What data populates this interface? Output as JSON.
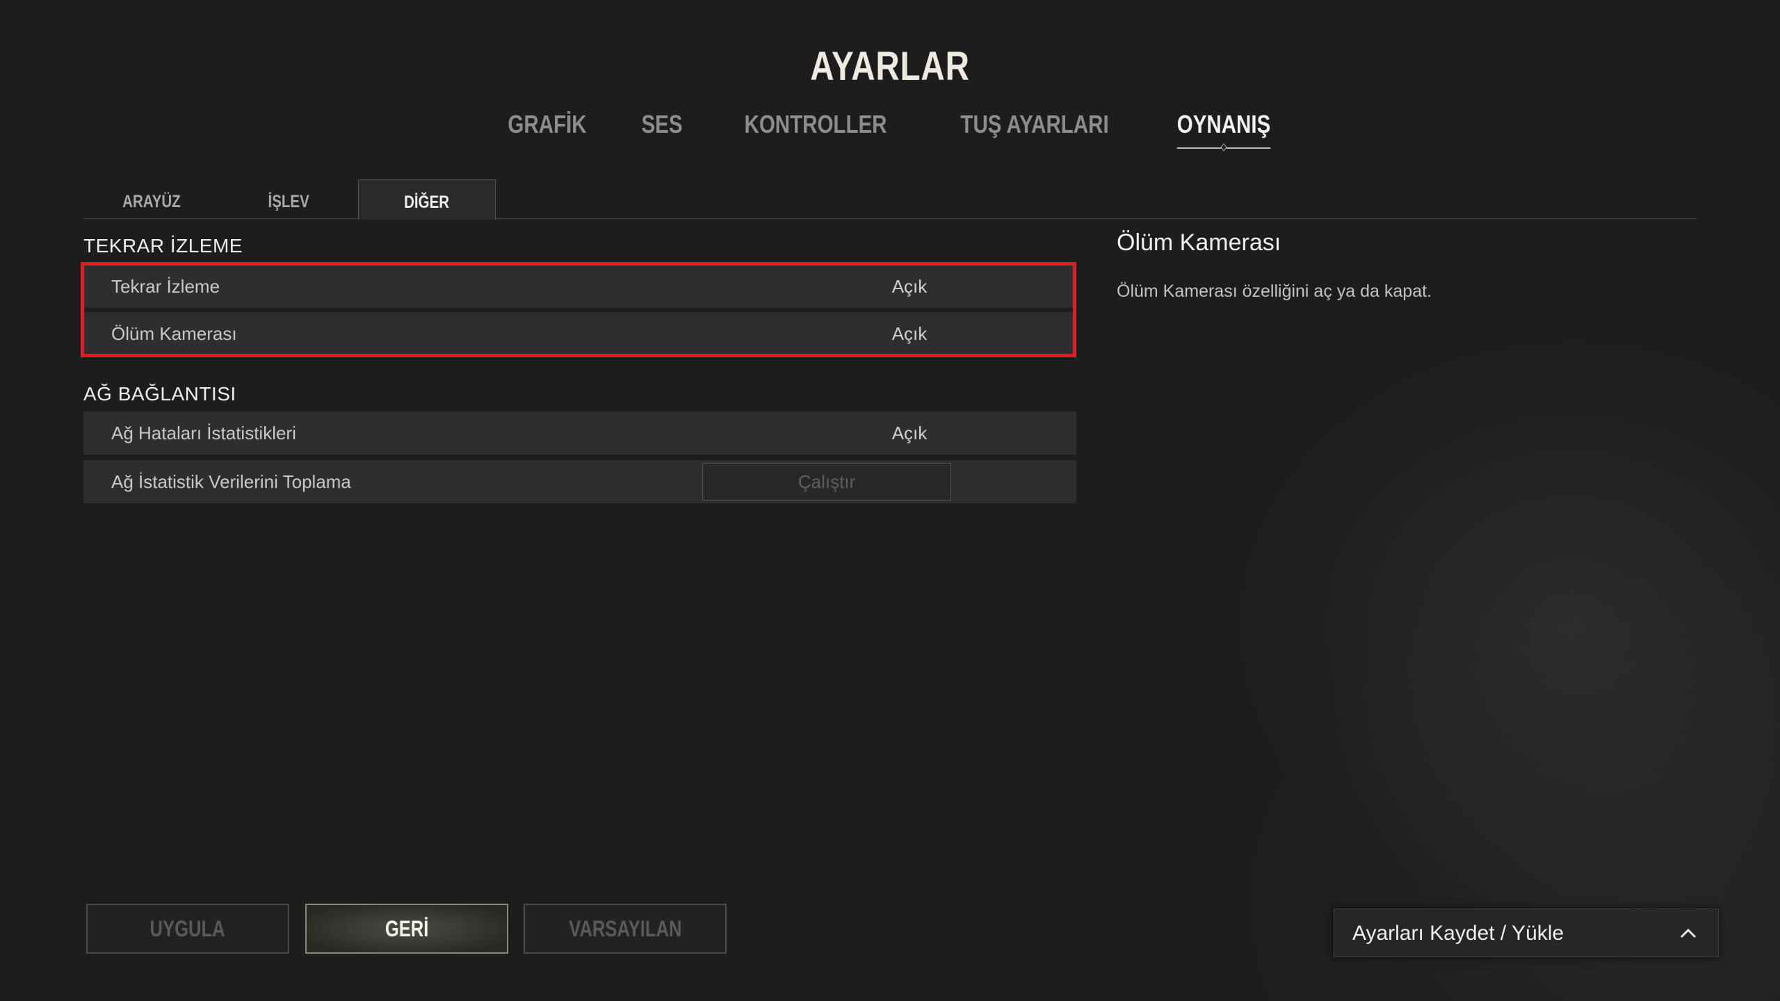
{
  "header": {
    "title": "AYARLAR"
  },
  "main_tabs": [
    {
      "label": "GRAFİK",
      "active": false
    },
    {
      "label": "SES",
      "active": false
    },
    {
      "label": "KONTROLLER",
      "active": false
    },
    {
      "label": "TUŞ AYARLARI",
      "active": false
    },
    {
      "label": "OYNANIŞ",
      "active": true
    }
  ],
  "sub_tabs": [
    {
      "label": "ARAYÜZ",
      "active": false
    },
    {
      "label": "İŞLEV",
      "active": false
    },
    {
      "label": "DİĞER",
      "active": true
    }
  ],
  "sections": {
    "replay": {
      "title": "TEKRAR İZLEME",
      "rows": [
        {
          "label": "Tekrar İzleme",
          "value": "Açık"
        },
        {
          "label": "Ölüm Kamerası",
          "value": "Açık"
        }
      ]
    },
    "network": {
      "title": "AĞ BAĞLANTISI",
      "rows": [
        {
          "label": "Ağ Hataları İstatistikleri",
          "value": "Açık"
        },
        {
          "label": "Ağ İstatistik Verilerini Toplama",
          "button": "Çalıştır"
        }
      ]
    }
  },
  "description": {
    "title": "Ölüm Kamerası",
    "text": "Ölüm Kamerası özelliğini aç ya da kapat."
  },
  "footer": {
    "apply_label": "UYGULA",
    "back_label": "GERİ",
    "default_label": "VARSAYILAN",
    "save_load_label": "Ayarları Kaydet / Yükle"
  },
  "colors": {
    "highlight": "#e01e2a",
    "background": "#1d1d1d",
    "row_bg": "#2e2e2e"
  },
  "icons": {
    "save_load_toggle": "chevron-up-icon"
  }
}
